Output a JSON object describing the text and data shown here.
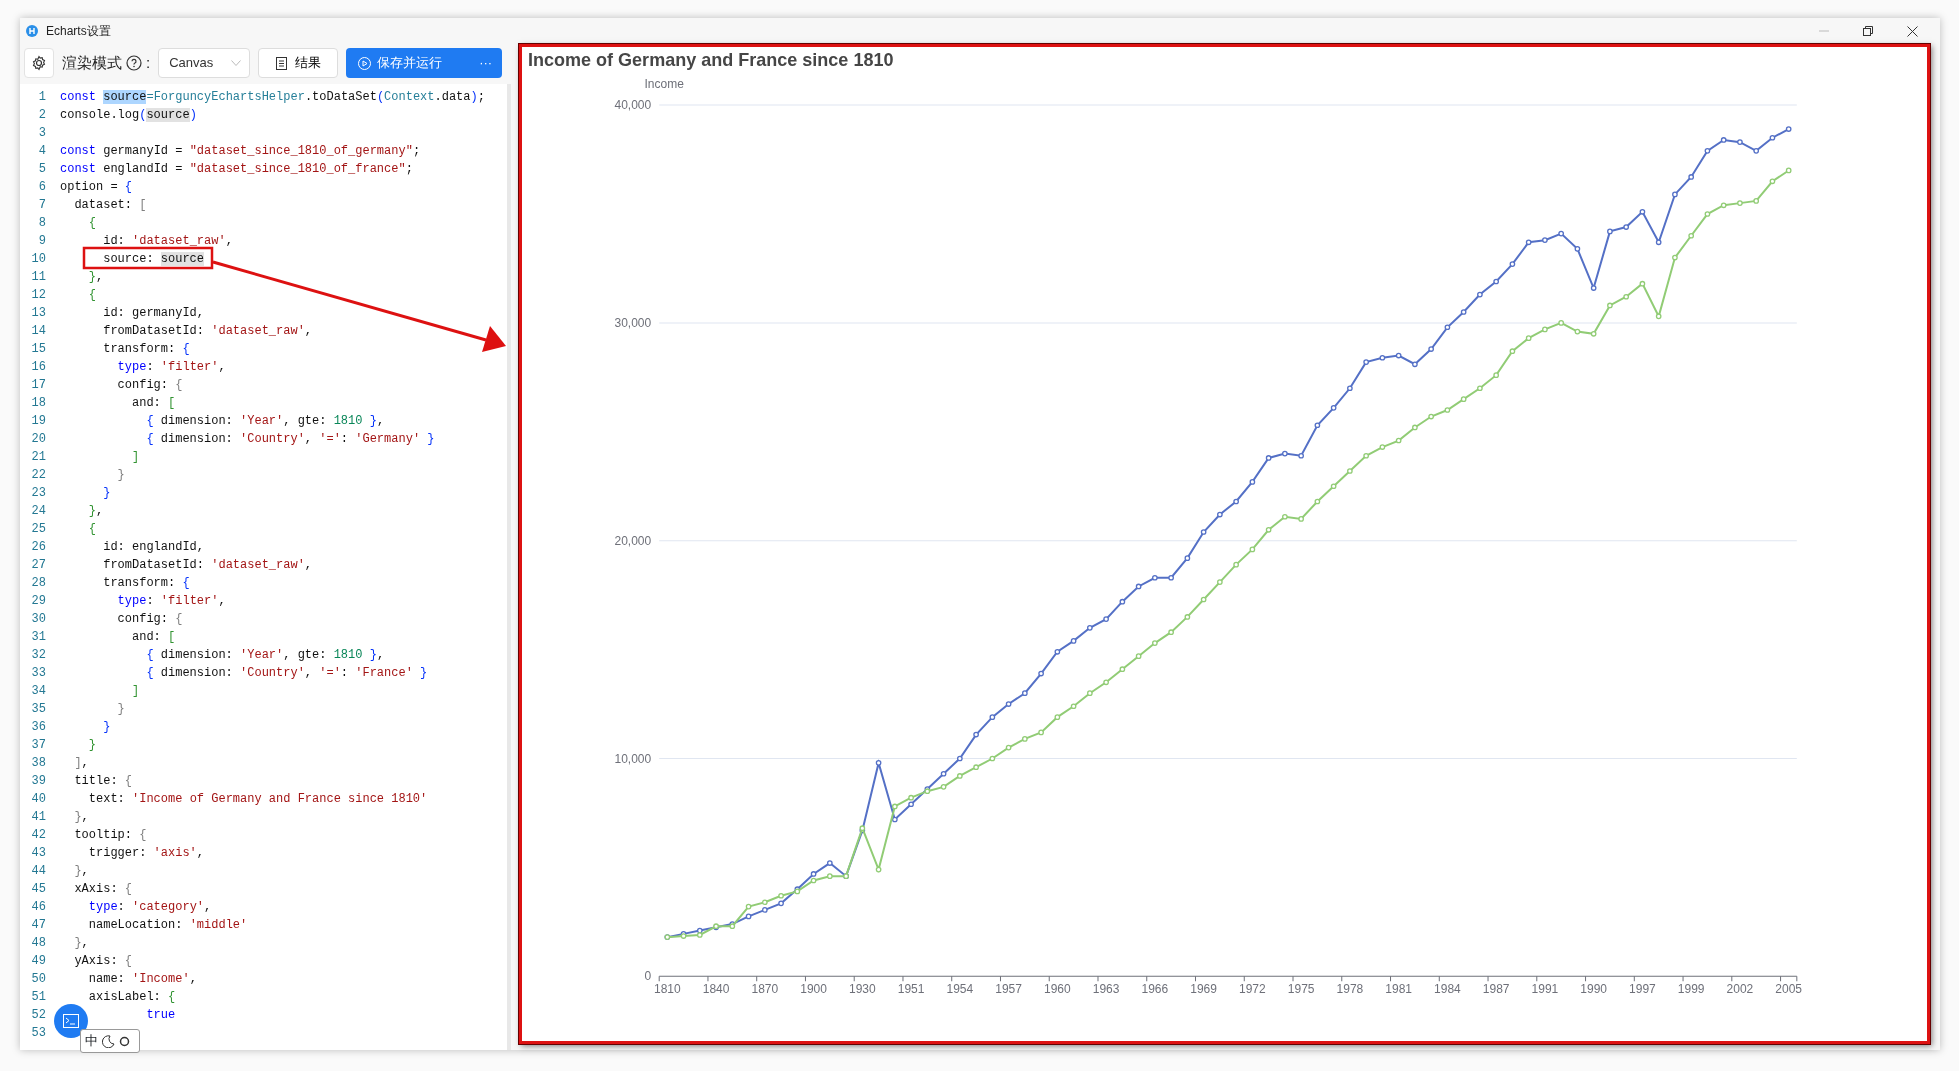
{
  "window": {
    "title": "Echarts设置"
  },
  "toolbar": {
    "render_mode_label": "渲染模式",
    "colon": ":",
    "render_mode": "Canvas",
    "result_button": "结果",
    "run_button": "保存并运行",
    "more": "···"
  },
  "editor": {
    "lines": [
      {
        "number": "1",
        "tokens": [
          {
            "kind": "keyword",
            "text": "const "
          },
          {
            "kind": "selected",
            "text": "source"
          },
          {
            "kind": "type",
            "text": "=ForguncyEchartsHelper"
          },
          {
            "kind": "plain",
            "text": ".toDataSet"
          },
          {
            "kind": "bracket1",
            "text": "("
          },
          {
            "kind": "type",
            "text": "Context"
          },
          {
            "kind": "plain",
            "text": ".data"
          },
          {
            "kind": "bracket1",
            "text": ")"
          },
          {
            "kind": "plain",
            "text": ";"
          }
        ]
      },
      {
        "number": "2",
        "tokens": [
          {
            "kind": "plain",
            "text": "console.log"
          },
          {
            "kind": "bracket1",
            "text": "("
          },
          {
            "kind": "highlight",
            "text": "source"
          },
          {
            "kind": "bracket1",
            "text": ")"
          }
        ]
      },
      {
        "number": "3"
      },
      {
        "number": "4",
        "tokens": [
          {
            "kind": "keyword",
            "text": "const "
          },
          {
            "kind": "plain",
            "text": "germanyId = "
          },
          {
            "kind": "string",
            "text": "\"dataset_since_1810_of_germany\""
          },
          {
            "kind": "plain",
            "text": ";"
          }
        ]
      },
      {
        "number": "5",
        "tokens": [
          {
            "kind": "keyword",
            "text": "const "
          },
          {
            "kind": "plain",
            "text": "englandId = "
          },
          {
            "kind": "string",
            "text": "\"dataset_since_1810_of_france\""
          },
          {
            "kind": "plain",
            "text": ";"
          }
        ]
      },
      {
        "number": "6",
        "tokens": [
          {
            "kind": "plain",
            "text": "option = "
          },
          {
            "kind": "bracket1",
            "text": "{"
          }
        ]
      },
      {
        "number": "7",
        "tokens": [
          {
            "kind": "plain",
            "text": "  dataset: "
          },
          {
            "kind": "bracket2",
            "text": "["
          }
        ]
      },
      {
        "number": "8",
        "tokens": [
          {
            "kind": "bracket3",
            "text": "    {"
          }
        ]
      },
      {
        "number": "9",
        "tokens": [
          {
            "kind": "plain",
            "text": "      id: "
          },
          {
            "kind": "string",
            "text": "'dataset_raw'"
          },
          {
            "kind": "plain",
            "text": ","
          }
        ]
      },
      {
        "number": "10",
        "tokens": [
          {
            "kind": "plain",
            "text": "      source: "
          },
          {
            "kind": "highlight",
            "text": "source"
          }
        ]
      },
      {
        "number": "11",
        "tokens": [
          {
            "kind": "bracket3",
            "text": "    }"
          },
          {
            "kind": "plain",
            "text": ","
          }
        ]
      },
      {
        "number": "12",
        "tokens": [
          {
            "kind": "bracket3",
            "text": "    {"
          }
        ]
      },
      {
        "number": "13",
        "tokens": [
          {
            "kind": "plain",
            "text": "      id: germanyId,"
          }
        ]
      },
      {
        "number": "14",
        "tokens": [
          {
            "kind": "plain",
            "text": "      fromDatasetId: "
          },
          {
            "kind": "string",
            "text": "'dataset_raw'"
          },
          {
            "kind": "plain",
            "text": ","
          }
        ]
      },
      {
        "number": "15",
        "tokens": [
          {
            "kind": "plain",
            "text": "      transform: "
          },
          {
            "kind": "bracket1",
            "text": "{"
          }
        ]
      },
      {
        "number": "16",
        "tokens": [
          {
            "kind": "keyword",
            "text": "        type"
          },
          {
            "kind": "plain",
            "text": ": "
          },
          {
            "kind": "string",
            "text": "'filter'"
          },
          {
            "kind": "plain",
            "text": ","
          }
        ]
      },
      {
        "number": "17",
        "tokens": [
          {
            "kind": "plain",
            "text": "        config: "
          },
          {
            "kind": "bracket2",
            "text": "{"
          }
        ]
      },
      {
        "number": "18",
        "tokens": [
          {
            "kind": "plain",
            "text": "          and: "
          },
          {
            "kind": "bracket3",
            "text": "["
          }
        ]
      },
      {
        "number": "19",
        "tokens": [
          {
            "kind": "bracket1",
            "text": "            {"
          },
          {
            "kind": "plain",
            "text": " dimension: "
          },
          {
            "kind": "string",
            "text": "'Year'"
          },
          {
            "kind": "plain",
            "text": ", gte: "
          },
          {
            "kind": "number",
            "text": "1810"
          },
          {
            "kind": "bracket1",
            "text": " }"
          },
          {
            "kind": "plain",
            "text": ","
          }
        ]
      },
      {
        "number": "20",
        "tokens": [
          {
            "kind": "bracket1",
            "text": "            {"
          },
          {
            "kind": "plain",
            "text": " dimension: "
          },
          {
            "kind": "string",
            "text": "'Country'"
          },
          {
            "kind": "plain",
            "text": ", "
          },
          {
            "kind": "string",
            "text": "'='"
          },
          {
            "kind": "plain",
            "text": ": "
          },
          {
            "kind": "string",
            "text": "'Germany'"
          },
          {
            "kind": "bracket1",
            "text": " }"
          }
        ]
      },
      {
        "number": "21",
        "tokens": [
          {
            "kind": "bracket3",
            "text": "          ]"
          }
        ]
      },
      {
        "number": "22",
        "tokens": [
          {
            "kind": "bracket2",
            "text": "        }"
          }
        ]
      },
      {
        "number": "23",
        "tokens": [
          {
            "kind": "bracket1",
            "text": "      }"
          }
        ]
      },
      {
        "number": "24",
        "tokens": [
          {
            "kind": "bracket3",
            "text": "    }"
          },
          {
            "kind": "plain",
            "text": ","
          }
        ]
      },
      {
        "number": "25",
        "tokens": [
          {
            "kind": "bracket3",
            "text": "    {"
          }
        ]
      },
      {
        "number": "26",
        "tokens": [
          {
            "kind": "plain",
            "text": "      id: englandId,"
          }
        ]
      },
      {
        "number": "27",
        "tokens": [
          {
            "kind": "plain",
            "text": "      fromDatasetId: "
          },
          {
            "kind": "string",
            "text": "'dataset_raw'"
          },
          {
            "kind": "plain",
            "text": ","
          }
        ]
      },
      {
        "number": "28",
        "tokens": [
          {
            "kind": "plain",
            "text": "      transform: "
          },
          {
            "kind": "bracket1",
            "text": "{"
          }
        ]
      },
      {
        "number": "29",
        "tokens": [
          {
            "kind": "keyword",
            "text": "        type"
          },
          {
            "kind": "plain",
            "text": ": "
          },
          {
            "kind": "string",
            "text": "'filter'"
          },
          {
            "kind": "plain",
            "text": ","
          }
        ]
      },
      {
        "number": "30",
        "tokens": [
          {
            "kind": "plain",
            "text": "        config: "
          },
          {
            "kind": "bracket2",
            "text": "{"
          }
        ]
      },
      {
        "number": "31",
        "tokens": [
          {
            "kind": "plain",
            "text": "          and: "
          },
          {
            "kind": "bracket3",
            "text": "["
          }
        ]
      },
      {
        "number": "32",
        "tokens": [
          {
            "kind": "bracket1",
            "text": "            {"
          },
          {
            "kind": "plain",
            "text": " dimension: "
          },
          {
            "kind": "string",
            "text": "'Year'"
          },
          {
            "kind": "plain",
            "text": ", gte: "
          },
          {
            "kind": "number",
            "text": "1810"
          },
          {
            "kind": "bracket1",
            "text": " }"
          },
          {
            "kind": "plain",
            "text": ","
          }
        ]
      },
      {
        "number": "33",
        "tokens": [
          {
            "kind": "bracket1",
            "text": "            {"
          },
          {
            "kind": "plain",
            "text": " dimension: "
          },
          {
            "kind": "string",
            "text": "'Country'"
          },
          {
            "kind": "plain",
            "text": ", "
          },
          {
            "kind": "string",
            "text": "'='"
          },
          {
            "kind": "plain",
            "text": ": "
          },
          {
            "kind": "string",
            "text": "'France'"
          },
          {
            "kind": "bracket1",
            "text": " }"
          }
        ]
      },
      {
        "number": "34",
        "tokens": [
          {
            "kind": "bracket3",
            "text": "          ]"
          }
        ]
      },
      {
        "number": "35",
        "tokens": [
          {
            "kind": "bracket2",
            "text": "        }"
          }
        ]
      },
      {
        "number": "36",
        "tokens": [
          {
            "kind": "bracket1",
            "text": "      }"
          }
        ]
      },
      {
        "number": "37",
        "tokens": [
          {
            "kind": "bracket3",
            "text": "    }"
          }
        ]
      },
      {
        "number": "38",
        "tokens": [
          {
            "kind": "bracket2",
            "text": "  ]"
          },
          {
            "kind": "plain",
            "text": ","
          }
        ]
      },
      {
        "number": "39",
        "tokens": [
          {
            "kind": "plain",
            "text": "  title: "
          },
          {
            "kind": "bracket2",
            "text": "{"
          }
        ]
      },
      {
        "number": "40",
        "tokens": [
          {
            "kind": "plain",
            "text": "    text: "
          },
          {
            "kind": "string",
            "text": "'Income of Germany and France since 1810'"
          }
        ]
      },
      {
        "number": "41",
        "tokens": [
          {
            "kind": "bracket2",
            "text": "  }"
          },
          {
            "kind": "plain",
            "text": ","
          }
        ]
      },
      {
        "number": "42",
        "tokens": [
          {
            "kind": "plain",
            "text": "  tooltip: "
          },
          {
            "kind": "bracket2",
            "text": "{"
          }
        ]
      },
      {
        "number": "43",
        "tokens": [
          {
            "kind": "plain",
            "text": "    trigger: "
          },
          {
            "kind": "string",
            "text": "'axis'"
          },
          {
            "kind": "plain",
            "text": ","
          }
        ]
      },
      {
        "number": "44",
        "tokens": [
          {
            "kind": "bracket2",
            "text": "  }"
          },
          {
            "kind": "plain",
            "text": ","
          }
        ]
      },
      {
        "number": "45",
        "tokens": [
          {
            "kind": "plain",
            "text": "  xAxis: "
          },
          {
            "kind": "bracket2",
            "text": "{"
          }
        ]
      },
      {
        "number": "46",
        "tokens": [
          {
            "kind": "keyword",
            "text": "    type"
          },
          {
            "kind": "plain",
            "text": ": "
          },
          {
            "kind": "string",
            "text": "'category'"
          },
          {
            "kind": "plain",
            "text": ","
          }
        ]
      },
      {
        "number": "47",
        "tokens": [
          {
            "kind": "plain",
            "text": "    nameLocation: "
          },
          {
            "kind": "string",
            "text": "'middle'"
          }
        ]
      },
      {
        "number": "48",
        "tokens": [
          {
            "kind": "bracket2",
            "text": "  }"
          },
          {
            "kind": "plain",
            "text": ","
          }
        ]
      },
      {
        "number": "49",
        "tokens": [
          {
            "kind": "plain",
            "text": "  yAxis: "
          },
          {
            "kind": "bracket2",
            "text": "{"
          }
        ]
      },
      {
        "number": "50",
        "tokens": [
          {
            "kind": "plain",
            "text": "    name: "
          },
          {
            "kind": "string",
            "text": "'Income'"
          },
          {
            "kind": "plain",
            "text": ","
          }
        ]
      },
      {
        "number": "51",
        "tokens": [
          {
            "kind": "plain",
            "text": "    axisLabel: "
          },
          {
            "kind": "bracket3",
            "text": "{"
          }
        ]
      },
      {
        "number": "52",
        "tokens": [
          {
            "kind": "keyword",
            "text": "            true"
          }
        ]
      },
      {
        "number": "53"
      }
    ]
  },
  "ime": {
    "mode": "中"
  },
  "chart": {
    "chart_data": {
      "type": "line",
      "title": "Income of Germany and France since 1810",
      "ylabel": "Income",
      "grid": true,
      "categories": [
        "1810",
        null,
        null,
        "1840",
        null,
        null,
        "1870",
        null,
        null,
        "1900",
        null,
        null,
        "1930",
        null,
        null,
        "1951",
        null,
        null,
        "1954",
        null,
        null,
        "1957",
        null,
        null,
        "1960",
        null,
        null,
        "1963",
        null,
        null,
        "1966",
        null,
        null,
        "1969",
        null,
        null,
        "1972",
        null,
        null,
        "1975",
        null,
        null,
        "1978",
        null,
        null,
        "1981",
        null,
        null,
        "1984",
        null,
        null,
        "1987",
        null,
        null,
        "1991",
        null,
        null,
        "1990",
        null,
        null,
        "1997",
        null,
        null,
        "1999",
        null,
        null,
        "2002",
        null,
        null,
        "2005"
      ],
      "ylim": [
        0,
        40000
      ],
      "yticks": [
        {
          "value": 0,
          "label": "0"
        },
        {
          "value": 10000,
          "label": "10,000"
        },
        {
          "value": 20000,
          "label": "20,000"
        },
        {
          "value": 30000,
          "label": "30,000"
        },
        {
          "value": 40000,
          "label": "40,000"
        }
      ],
      "series": [
        {
          "color": "#5470c6",
          "marker": "circle",
          "values": [
            1800,
            1950,
            2100,
            2250,
            2400,
            2750,
            3050,
            3350,
            4000,
            4700,
            5200,
            4600,
            6700,
            9800,
            7200,
            7900,
            8600,
            9300,
            10000,
            11100,
            11900,
            12500,
            13000,
            13900,
            14900,
            15400,
            16000,
            16400,
            17200,
            17900,
            18300,
            18300,
            19200,
            20400,
            21200,
            21800,
            22700,
            23800,
            24000,
            23900,
            25300,
            26100,
            27000,
            28200,
            28400,
            28500,
            28100,
            28800,
            29800,
            30500,
            31300,
            31900,
            32700,
            33700,
            33800,
            34100,
            33400,
            31600,
            34200,
            34400,
            35100,
            33700,
            35900,
            36700,
            37900,
            38400,
            38300,
            37900,
            38500,
            38900
          ]
        },
        {
          "color": "#91cc75",
          "marker": "circle",
          "values": [
            1800,
            1850,
            1900,
            2300,
            2300,
            3200,
            3400,
            3700,
            3900,
            4400,
            4600,
            4600,
            6800,
            4900,
            7800,
            8200,
            8500,
            8700,
            9200,
            9600,
            10000,
            10500,
            10900,
            11200,
            11900,
            12400,
            13000,
            13500,
            14100,
            14700,
            15300,
            15800,
            16500,
            17300,
            18100,
            18900,
            19600,
            20500,
            21100,
            21000,
            21800,
            22500,
            23200,
            23900,
            24300,
            24600,
            25200,
            25700,
            26000,
            26500,
            27000,
            27600,
            28700,
            29300,
            29700,
            30000,
            29600,
            29500,
            30800,
            31200,
            31800,
            30300,
            33000,
            34000,
            35000,
            35400,
            35500,
            35600,
            36500,
            37000
          ]
        }
      ]
    }
  }
}
